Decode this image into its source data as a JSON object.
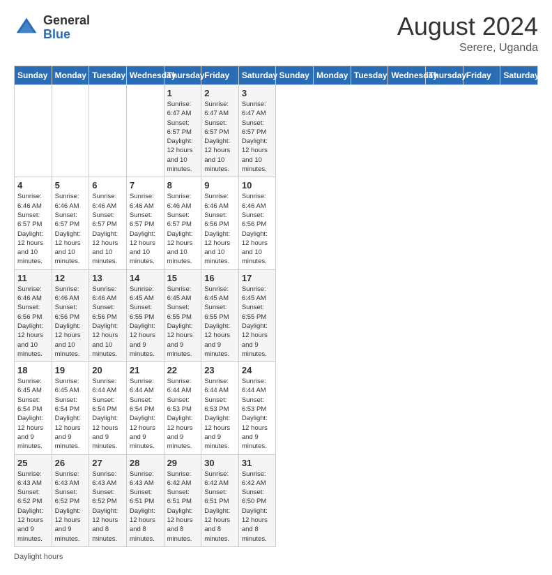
{
  "header": {
    "logo_general": "General",
    "logo_blue": "Blue",
    "month_year": "August 2024",
    "location": "Serere, Uganda"
  },
  "days_of_week": [
    "Sunday",
    "Monday",
    "Tuesday",
    "Wednesday",
    "Thursday",
    "Friday",
    "Saturday"
  ],
  "weeks": [
    [
      {
        "day": "",
        "info": ""
      },
      {
        "day": "",
        "info": ""
      },
      {
        "day": "",
        "info": ""
      },
      {
        "day": "",
        "info": ""
      },
      {
        "day": "1",
        "info": "Sunrise: 6:47 AM\nSunset: 6:57 PM\nDaylight: 12 hours and 10 minutes."
      },
      {
        "day": "2",
        "info": "Sunrise: 6:47 AM\nSunset: 6:57 PM\nDaylight: 12 hours and 10 minutes."
      },
      {
        "day": "3",
        "info": "Sunrise: 6:47 AM\nSunset: 6:57 PM\nDaylight: 12 hours and 10 minutes."
      }
    ],
    [
      {
        "day": "4",
        "info": "Sunrise: 6:46 AM\nSunset: 6:57 PM\nDaylight: 12 hours and 10 minutes."
      },
      {
        "day": "5",
        "info": "Sunrise: 6:46 AM\nSunset: 6:57 PM\nDaylight: 12 hours and 10 minutes."
      },
      {
        "day": "6",
        "info": "Sunrise: 6:46 AM\nSunset: 6:57 PM\nDaylight: 12 hours and 10 minutes."
      },
      {
        "day": "7",
        "info": "Sunrise: 6:46 AM\nSunset: 6:57 PM\nDaylight: 12 hours and 10 minutes."
      },
      {
        "day": "8",
        "info": "Sunrise: 6:46 AM\nSunset: 6:57 PM\nDaylight: 12 hours and 10 minutes."
      },
      {
        "day": "9",
        "info": "Sunrise: 6:46 AM\nSunset: 6:56 PM\nDaylight: 12 hours and 10 minutes."
      },
      {
        "day": "10",
        "info": "Sunrise: 6:46 AM\nSunset: 6:56 PM\nDaylight: 12 hours and 10 minutes."
      }
    ],
    [
      {
        "day": "11",
        "info": "Sunrise: 6:46 AM\nSunset: 6:56 PM\nDaylight: 12 hours and 10 minutes."
      },
      {
        "day": "12",
        "info": "Sunrise: 6:46 AM\nSunset: 6:56 PM\nDaylight: 12 hours and 10 minutes."
      },
      {
        "day": "13",
        "info": "Sunrise: 6:46 AM\nSunset: 6:56 PM\nDaylight: 12 hours and 10 minutes."
      },
      {
        "day": "14",
        "info": "Sunrise: 6:45 AM\nSunset: 6:55 PM\nDaylight: 12 hours and 9 minutes."
      },
      {
        "day": "15",
        "info": "Sunrise: 6:45 AM\nSunset: 6:55 PM\nDaylight: 12 hours and 9 minutes."
      },
      {
        "day": "16",
        "info": "Sunrise: 6:45 AM\nSunset: 6:55 PM\nDaylight: 12 hours and 9 minutes."
      },
      {
        "day": "17",
        "info": "Sunrise: 6:45 AM\nSunset: 6:55 PM\nDaylight: 12 hours and 9 minutes."
      }
    ],
    [
      {
        "day": "18",
        "info": "Sunrise: 6:45 AM\nSunset: 6:54 PM\nDaylight: 12 hours and 9 minutes."
      },
      {
        "day": "19",
        "info": "Sunrise: 6:45 AM\nSunset: 6:54 PM\nDaylight: 12 hours and 9 minutes."
      },
      {
        "day": "20",
        "info": "Sunrise: 6:44 AM\nSunset: 6:54 PM\nDaylight: 12 hours and 9 minutes."
      },
      {
        "day": "21",
        "info": "Sunrise: 6:44 AM\nSunset: 6:54 PM\nDaylight: 12 hours and 9 minutes."
      },
      {
        "day": "22",
        "info": "Sunrise: 6:44 AM\nSunset: 6:53 PM\nDaylight: 12 hours and 9 minutes."
      },
      {
        "day": "23",
        "info": "Sunrise: 6:44 AM\nSunset: 6:53 PM\nDaylight: 12 hours and 9 minutes."
      },
      {
        "day": "24",
        "info": "Sunrise: 6:44 AM\nSunset: 6:53 PM\nDaylight: 12 hours and 9 minutes."
      }
    ],
    [
      {
        "day": "25",
        "info": "Sunrise: 6:43 AM\nSunset: 6:52 PM\nDaylight: 12 hours and 9 minutes."
      },
      {
        "day": "26",
        "info": "Sunrise: 6:43 AM\nSunset: 6:52 PM\nDaylight: 12 hours and 9 minutes."
      },
      {
        "day": "27",
        "info": "Sunrise: 6:43 AM\nSunset: 6:52 PM\nDaylight: 12 hours and 8 minutes."
      },
      {
        "day": "28",
        "info": "Sunrise: 6:43 AM\nSunset: 6:51 PM\nDaylight: 12 hours and 8 minutes."
      },
      {
        "day": "29",
        "info": "Sunrise: 6:42 AM\nSunset: 6:51 PM\nDaylight: 12 hours and 8 minutes."
      },
      {
        "day": "30",
        "info": "Sunrise: 6:42 AM\nSunset: 6:51 PM\nDaylight: 12 hours and 8 minutes."
      },
      {
        "day": "31",
        "info": "Sunrise: 6:42 AM\nSunset: 6:50 PM\nDaylight: 12 hours and 8 minutes."
      }
    ]
  ],
  "footer": {
    "note": "Daylight hours"
  }
}
